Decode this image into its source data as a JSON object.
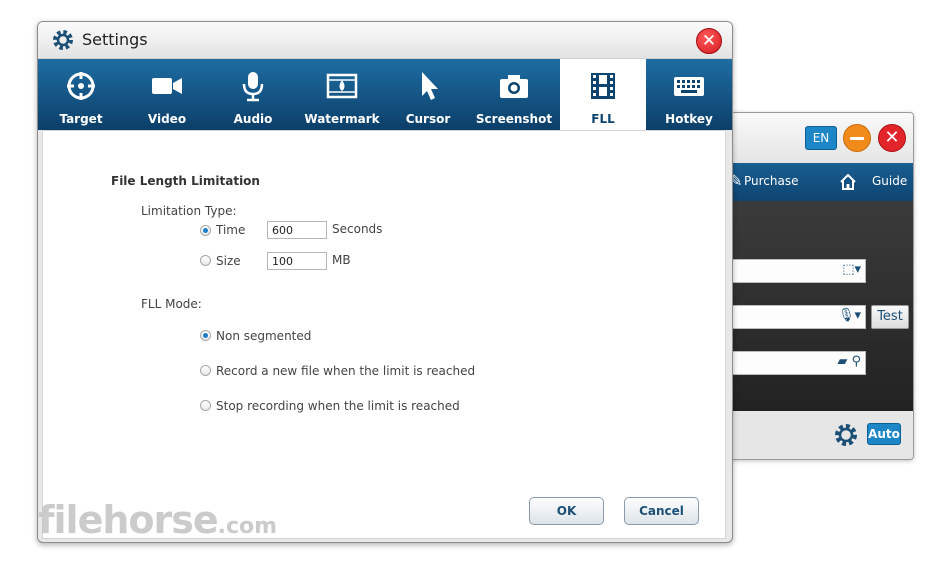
{
  "bg_window": {
    "lang": "EN",
    "nav": {
      "purchase": "Purchase",
      "guide": "Guide"
    },
    "test_label": "Test",
    "auto_label": "Auto"
  },
  "dialog": {
    "title": "Settings",
    "tabs": [
      {
        "label": "Target",
        "icon": "target-icon"
      },
      {
        "label": "Video",
        "icon": "video-camera-icon"
      },
      {
        "label": "Audio",
        "icon": "microphone-icon"
      },
      {
        "label": "Watermark",
        "icon": "watermark-icon"
      },
      {
        "label": "Cursor",
        "icon": "cursor-icon"
      },
      {
        "label": "Screenshot",
        "icon": "camera-icon"
      },
      {
        "label": "FLL",
        "icon": "film-icon",
        "active": true
      },
      {
        "label": "Hotkey",
        "icon": "keyboard-icon"
      }
    ],
    "fll": {
      "section_title": "File Length Limitation",
      "limitation_type_label": "Limitation Type:",
      "time_label": "Time",
      "time_value": "600",
      "time_unit": "Seconds",
      "size_label": "Size",
      "size_value": "100",
      "size_unit": "MB",
      "mode_label": "FLL Mode:",
      "mode_options": [
        "Non segmented",
        "Record a new file when the limit is reached",
        "Stop recording when the limit is reached"
      ]
    },
    "ok_label": "OK",
    "cancel_label": "Cancel"
  },
  "watermark": {
    "text": "filehorse",
    "suffix": ".com"
  },
  "colors": {
    "nav_dark": "#0e4470",
    "nav_light": "#1e6da3",
    "accent": "#1e7fc8",
    "close_red": "#e2252b",
    "minimize_orange": "#f08a1b"
  }
}
